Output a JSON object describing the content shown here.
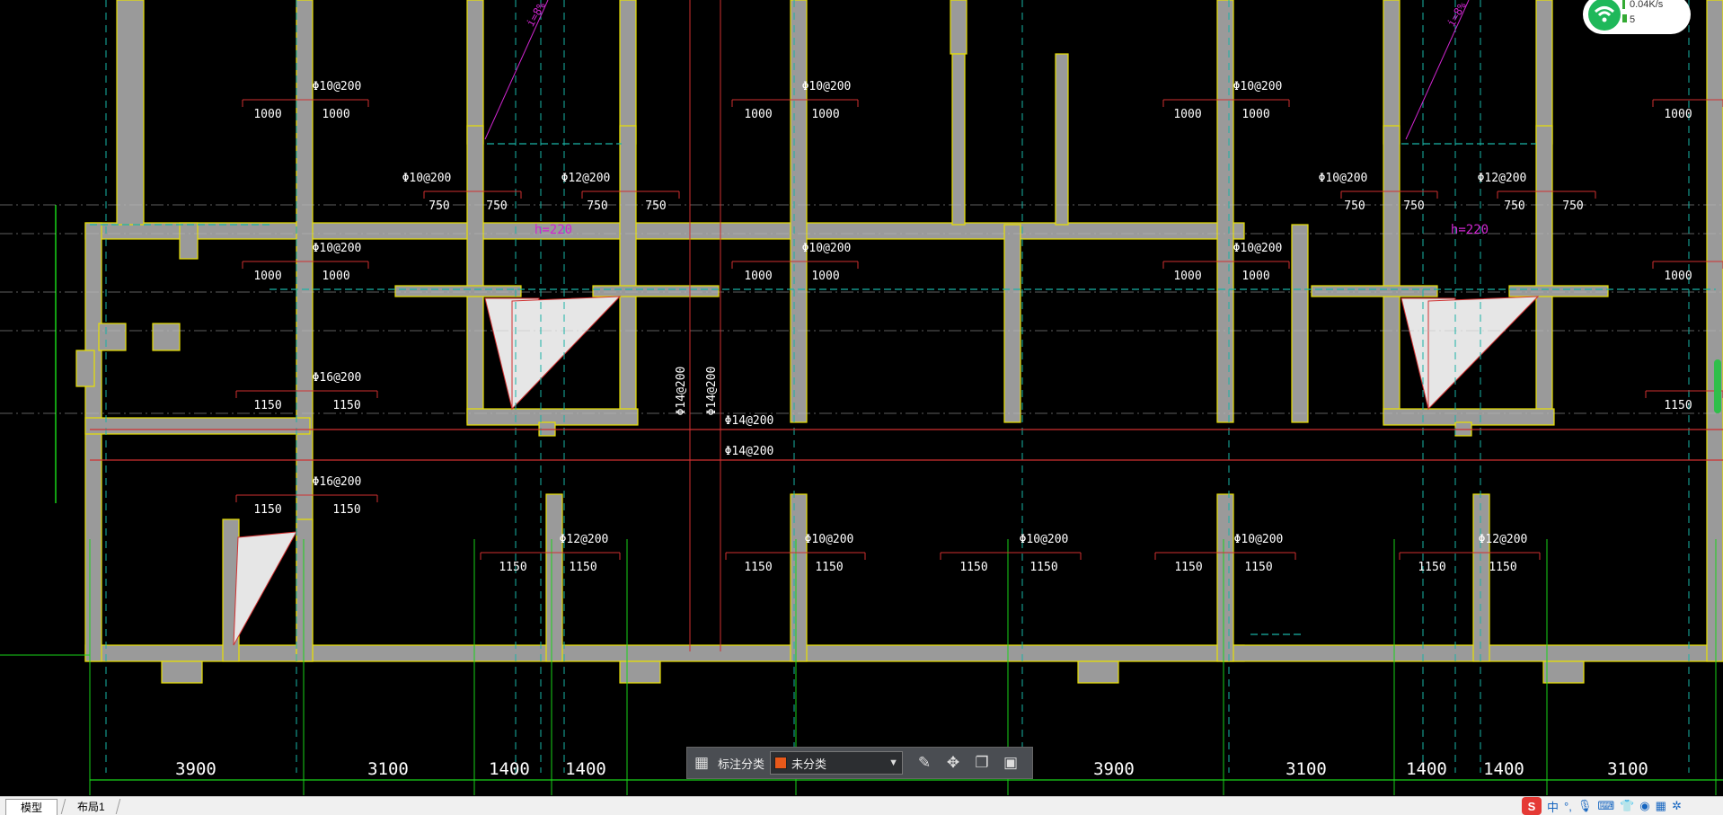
{
  "drawing": {
    "rebar_labels": [
      "Φ10@200",
      "Φ12@200",
      "Φ16@200",
      "Φ14@200"
    ],
    "spacing_labels": [
      "1000",
      "750",
      "1150"
    ],
    "height_label": "h=220",
    "ramp_label": "i=8%",
    "axis_dimensions": [
      "3900",
      "3100",
      "1400",
      "1400",
      "3900",
      "3100",
      "1400",
      "1400",
      "3100"
    ],
    "colors": {
      "background": "#000000",
      "wall_fill": "#9a9a9a",
      "wall_outline": "#e8e000",
      "axis": "#19d219",
      "dashed": "#19b3a6",
      "dimension": "#d03030",
      "text": "#ffffff",
      "magenta": "#d026d0"
    }
  },
  "wifi": {
    "speed": "0.04K/s",
    "count": "5",
    "icon": "wifi-icon"
  },
  "toolbar": {
    "grid_icon": "grid-icon",
    "label": "标注分类",
    "select_value": "未分类",
    "select_color": "#e8591a",
    "tools": [
      "edit-icon",
      "move-icon",
      "copy-icon",
      "paste-icon"
    ]
  },
  "tabs": {
    "model": "模型",
    "layout": "布局1"
  },
  "tray": {
    "logo": "S",
    "ime": "中",
    "items": [
      "punct-icon",
      "mic-icon",
      "keyboard-icon",
      "shirt-icon",
      "game-icon",
      "grid-icon",
      "settings-icon"
    ]
  }
}
